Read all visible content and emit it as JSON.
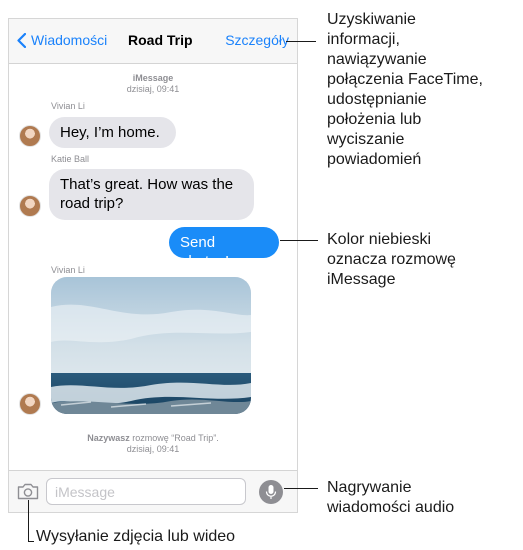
{
  "navbar": {
    "back_label": "Wiadomości",
    "title": "Road Trip",
    "details_label": "Szczegóły"
  },
  "conversation": {
    "header_service": "iMessage",
    "header_date": "dzisiaj, 09:41",
    "messages": [
      {
        "sender": "Vivian Li",
        "text": "Hey, I’m home."
      },
      {
        "sender": "Katie Ball",
        "text": "That’s great. How was the road trip?"
      },
      {
        "sender": "",
        "text": "Send photos!"
      },
      {
        "sender": "Vivian Li",
        "text": ""
      }
    ],
    "footer_bold": "Nazywasz",
    "footer_rest": "rozmowę “Road Trip”.",
    "footer_date": "dzisiaj, 09:41"
  },
  "input": {
    "placeholder": "iMessage"
  },
  "callouts": {
    "details": [
      "Uzyskiwanie",
      "informacji,",
      "nawiązywanie",
      "połączenia FaceTime,",
      "udostępnianie",
      "położenia lub",
      "wyciszanie",
      "powiadomień"
    ],
    "blue": [
      "Kolor niebieski",
      "oznacza rozmowę",
      "iMessage"
    ],
    "audio": [
      "Nagrywanie",
      "wiadomości audio"
    ],
    "camera": "Wysyłanie zdjęcia lub wideo"
  },
  "colors": {
    "accent": "#1a82fb",
    "blue_bubble": "#1a8cf8",
    "gray_bubble": "#e5e5ea"
  },
  "icons": [
    "chevron-left-icon",
    "camera-icon",
    "microphone-icon"
  ]
}
